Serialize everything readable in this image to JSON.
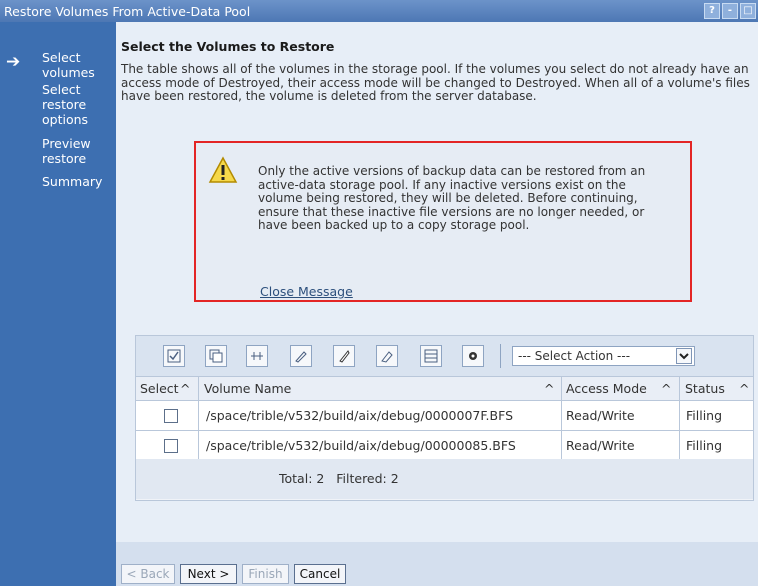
{
  "window": {
    "title": "Restore Volumes From Active-Data Pool",
    "controls": [
      "?",
      "-",
      "□"
    ]
  },
  "nav": {
    "items": [
      {
        "label": "Select volumes",
        "current": true
      },
      {
        "label": "Select restore options",
        "current": false
      },
      {
        "label": "Preview restore",
        "current": false
      },
      {
        "label": "Summary",
        "current": false
      }
    ]
  },
  "main": {
    "heading": "Select the Volumes to Restore",
    "description": "The table shows all of the volumes in the storage pool. If the volumes you select do not already have an access mode of Destroyed, their access mode will be changed to Destroyed. When all of a volume's files have been restored, the volume is deleted from the server database."
  },
  "message": {
    "text": "Only the active versions of backup data can be restored from an active-data storage pool. If any inactive versions exist on the volume being restored, they will be deleted. Before continuing, ensure that these inactive file versions are no longer needed, or have been backed up to a copy storage pool.",
    "close_label": "Close Message"
  },
  "table": {
    "action_select": "--- Select Action ---",
    "columns": [
      "Select",
      "Volume Name",
      "Access Mode",
      "Status"
    ],
    "rows": [
      {
        "volume": "/space/trible/v532/build/aix/debug/0000007F.BFS",
        "access_mode": "Read/Write",
        "status": "Filling"
      },
      {
        "volume": "/space/trible/v532/build/aix/debug/00000085.BFS",
        "access_mode": "Read/Write",
        "status": "Filling"
      }
    ],
    "footer": "Total: 2   Filtered: 2"
  },
  "buttons": {
    "back": "< Back",
    "next": "Next >",
    "finish": "Finish",
    "cancel": "Cancel"
  }
}
